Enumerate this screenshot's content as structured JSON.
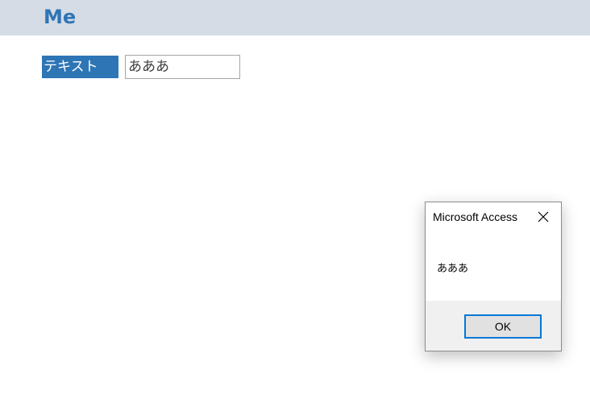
{
  "form": {
    "title": "Me",
    "field": {
      "label": "テキスト",
      "value": "あああ"
    }
  },
  "dialog": {
    "title": "Microsoft Access",
    "message": "あああ",
    "ok_label": "OK",
    "close_icon": "close-icon"
  },
  "colors": {
    "header_bg": "#d6dce5",
    "title_text": "#2e75b6",
    "label_bg": "#2e75b6",
    "dialog_focus": "#0078d7"
  }
}
